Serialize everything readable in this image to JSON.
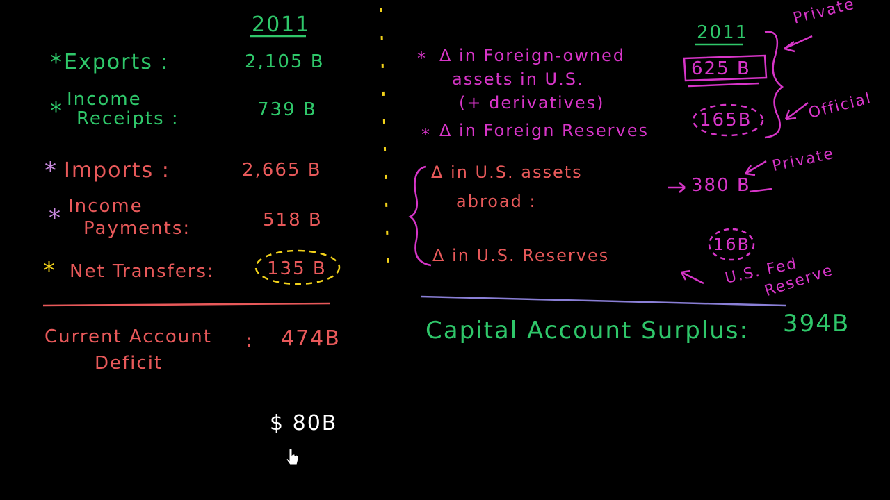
{
  "left": {
    "year": "2011",
    "rows": [
      {
        "star": "*",
        "label": "Exports :",
        "value": "2,105 B"
      },
      {
        "star": "*",
        "label_line1": "Income",
        "label_line2": "Receipts :",
        "value": "739 B"
      },
      {
        "star": "*",
        "label": "Imports :",
        "value": "2,665 B"
      },
      {
        "star": "*",
        "label_line1": "Income",
        "label_line2": "Payments:",
        "value": "518 B"
      },
      {
        "star": "*",
        "label": "Net Transfers:",
        "value": "135 B"
      }
    ],
    "result_line1": "Current Account",
    "result_line2": "Deficit",
    "result_colon": ":",
    "result_value": "474B",
    "extra": "$ 80B"
  },
  "right": {
    "year": "2011",
    "rows": [
      {
        "star": "*",
        "line1": "Δ in Foreign-owned",
        "line2": "assets in U.S.",
        "line3": "(+ derivatives)",
        "value": "625 B"
      },
      {
        "star": "*",
        "label": "Δ in Foreign Reserves",
        "value": "165B"
      },
      {
        "label_line1": "Δ in U.S. assets",
        "label_line2": "abroad :",
        "value": "380 B"
      },
      {
        "label": "Δ in U.S. Reserves",
        "value": "16B"
      }
    ],
    "annotations": {
      "private_top": "Private",
      "official": "Official",
      "private_mid": "Private",
      "us_fed": "U.S. Fed",
      "reserve": "Reserve"
    },
    "result": "Capital Account Surplus:",
    "result_value": "394B"
  },
  "colors": {
    "background": "#000000",
    "green": "#2fc76a",
    "red": "#e8595a",
    "magenta": "#d735c8",
    "pink": "#c98adf",
    "yellow": "#f2d21a",
    "purple": "#8a7fd6",
    "white": "#ffffff"
  }
}
